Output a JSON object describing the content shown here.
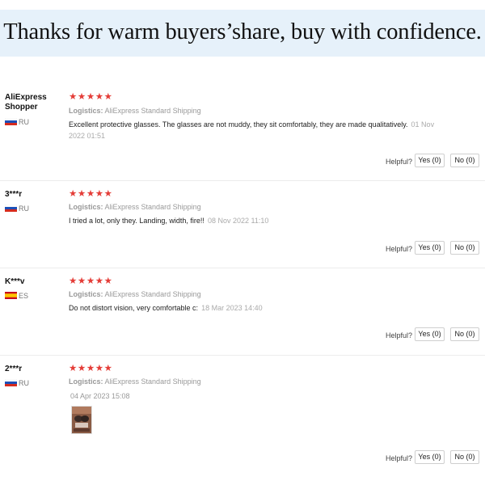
{
  "banner": {
    "text": "Thanks for warm buyers’share, buy with confidence."
  },
  "stars": "★★★★★",
  "logistics_label": "Logistics:",
  "helpful_label": "Helpful?",
  "reviews": [
    {
      "user": "AliExpress Shopper",
      "country": "RU",
      "rating": 5,
      "logistics": "AliExpress Standard Shipping",
      "text": "Excellent protective glasses. The glasses are not muddy, they sit comfortably, they are made qualitatively.",
      "date": "01 Nov 2022 01:51",
      "yes": "Yes (0)",
      "no": "No (0)"
    },
    {
      "user": "3***r",
      "country": "RU",
      "rating": 5,
      "logistics": "AliExpress Standard Shipping",
      "text": "I tried a lot, only they. Landing, width, fire!!",
      "date": "08 Nov 2022 11:10",
      "yes": "Yes (0)",
      "no": "No (0)"
    },
    {
      "user": "K***v",
      "country": "ES",
      "rating": 5,
      "logistics": "AliExpress Standard Shipping",
      "text": "Do not distort vision, very comfortable c:",
      "date": "18 Mar 2023 14:40",
      "yes": "Yes (0)",
      "no": "No (0)"
    },
    {
      "user": "2***r",
      "country": "RU",
      "rating": 5,
      "logistics": "AliExpress Standard Shipping",
      "text": "",
      "date": "04 Apr 2023 15:08",
      "yes": "Yes (0)",
      "no": "No (0)"
    }
  ],
  "colors": {
    "star": "#e43d38",
    "banner_bg": "#e6f1fa",
    "muted": "#999999"
  },
  "icons": {
    "ru_flag": "russia-flag-icon",
    "es_flag": "spain-flag-icon"
  }
}
